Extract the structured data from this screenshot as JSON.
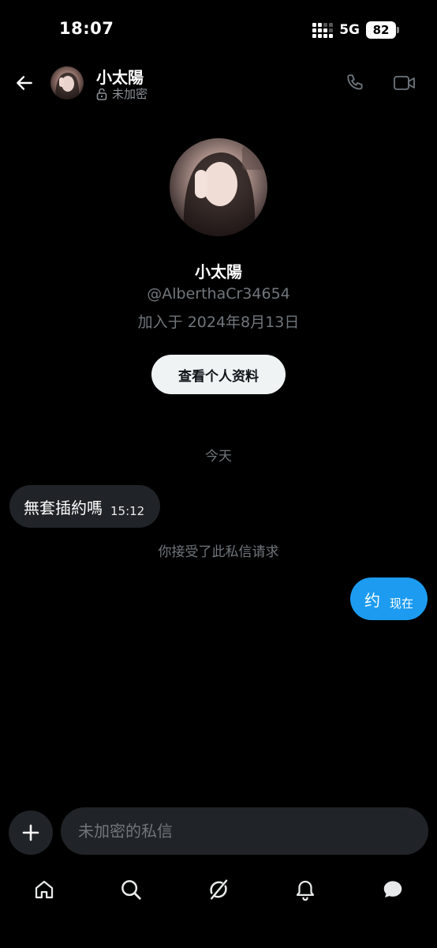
{
  "status_bar": {
    "time": "18:07",
    "network": "5G",
    "battery": "82"
  },
  "header": {
    "title": "小太陽",
    "subtitle": "未加密"
  },
  "profile": {
    "name": "小太陽",
    "handle": "@AlberthaCr34654",
    "joined": "加入于 2024年8月13日",
    "view_profile_label": "查看个人资料"
  },
  "conversation": {
    "day_separator": "今天",
    "messages": [
      {
        "direction": "incoming",
        "text": "無套插約嗎",
        "time": "15:12"
      },
      {
        "direction": "outgoing",
        "text": "约",
        "time": "现在"
      }
    ],
    "system_note": "你接受了此私信请求"
  },
  "composer": {
    "placeholder": "未加密的私信"
  },
  "bottom_nav": {
    "items": [
      {
        "icon": "home-icon"
      },
      {
        "icon": "search-icon"
      },
      {
        "icon": "grok-icon"
      },
      {
        "icon": "bell-icon"
      },
      {
        "icon": "messages-icon",
        "active": true
      }
    ]
  },
  "colors": {
    "accent": "#1d9bf0",
    "bubble_incoming": "#202327",
    "muted_text": "#71767b",
    "background": "#000000"
  }
}
